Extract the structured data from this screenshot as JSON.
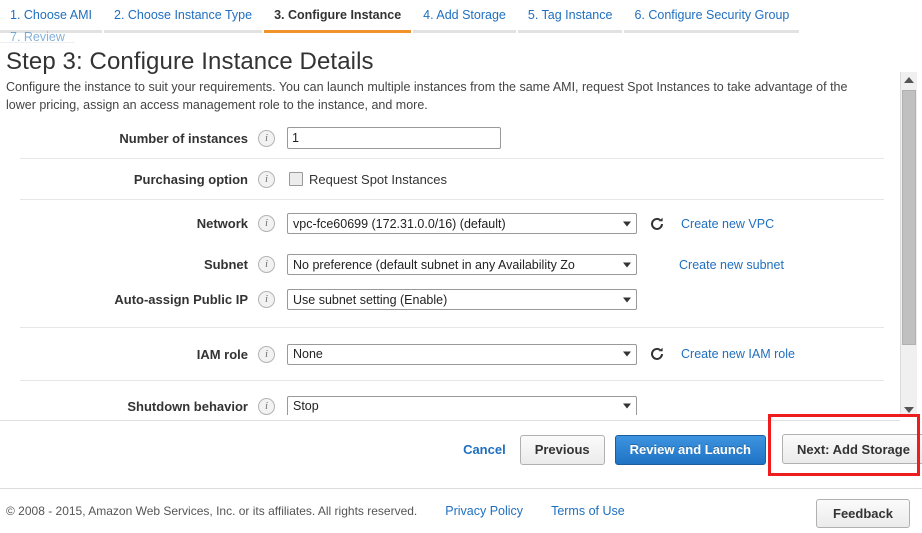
{
  "wizard": {
    "tabs": [
      {
        "label": "1. Choose AMI",
        "active": false
      },
      {
        "label": "2. Choose Instance Type",
        "active": false
      },
      {
        "label": "3. Configure Instance",
        "active": true
      },
      {
        "label": "4. Add Storage",
        "active": false
      },
      {
        "label": "5. Tag Instance",
        "active": false
      },
      {
        "label": "6. Configure Security Group",
        "active": false
      }
    ],
    "partial_tabs": [
      {
        "label": "7. Review"
      }
    ]
  },
  "page": {
    "title": "Step 3: Configure Instance Details",
    "description": "Configure the instance to suit your requirements. You can launch multiple instances from the same AMI, request Spot Instances to take advantage of the lower pricing, assign an access management role to the instance, and more."
  },
  "form": {
    "number_of_instances": {
      "label": "Number of instances",
      "value": "1",
      "info": "info-icon"
    },
    "purchasing_option": {
      "label": "Purchasing option",
      "checkbox_label": "Request Spot Instances",
      "checked": false
    },
    "network": {
      "label": "Network",
      "value": "vpc-fce60699 (172.31.0.0/16) (default)",
      "refresh": "refresh-icon",
      "link": "Create new VPC"
    },
    "subnet": {
      "label": "Subnet",
      "value": "No preference (default subnet in any Availability Zo",
      "link": "Create new subnet"
    },
    "auto_assign_public_ip": {
      "label": "Auto-assign Public IP",
      "value": "Use subnet setting (Enable)"
    },
    "iam_role": {
      "label": "IAM role",
      "value": "None",
      "refresh": "refresh-icon",
      "link": "Create new IAM role"
    },
    "shutdown_behavior": {
      "label": "Shutdown behavior",
      "value": "Stop"
    }
  },
  "actions": {
    "cancel": "Cancel",
    "previous": "Previous",
    "review_and_launch": "Review and Launch",
    "next": "Next: Add Storage"
  },
  "footer": {
    "copyright": "© 2008 - 2015, Amazon Web Services, Inc. or its affiliates. All rights reserved.",
    "privacy_policy": "Privacy Policy",
    "terms_of_use": "Terms of Use",
    "feedback": "Feedback"
  },
  "colors": {
    "link_blue": "#1f6fbf",
    "active_tab_underline": "#f0932b",
    "primary_button": "#1f73c4",
    "highlight_red": "#ee1c1c"
  }
}
